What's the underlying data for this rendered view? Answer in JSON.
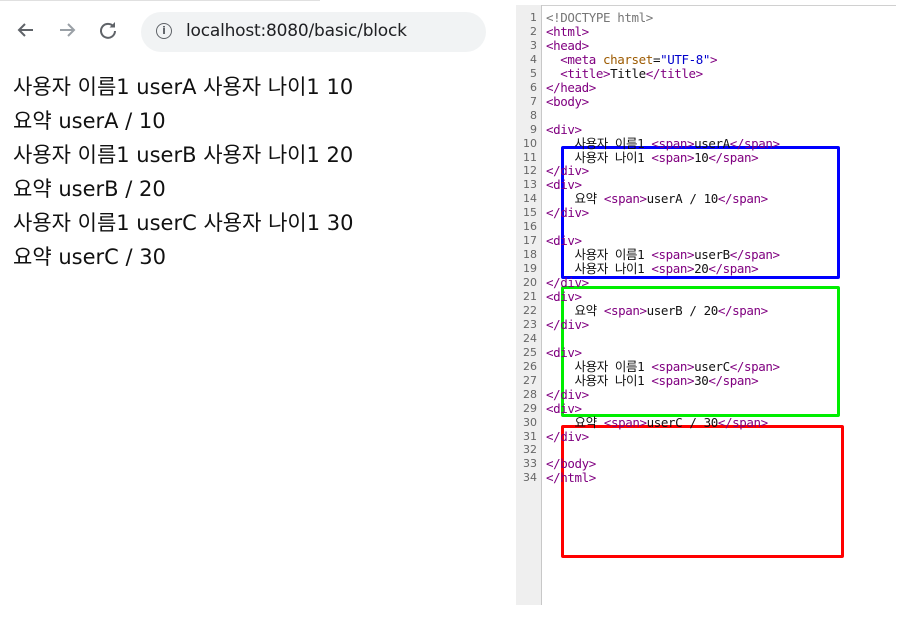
{
  "browser": {
    "back_icon": "arrow-left-icon",
    "forward_icon": "arrow-right-icon",
    "reload_icon": "reload-icon",
    "info_icon": "info-icon",
    "url": "localhost:8080/basic/block"
  },
  "page": {
    "lines": [
      "사용자 이름1 userA 사용자 나이1 10",
      "요약 userA / 10",
      "사용자 이름1 userB 사용자 나이1 20",
      "요약 userB / 20",
      "사용자 이름1 userC 사용자 나이1 30",
      "요약 userC / 30"
    ]
  },
  "editor": {
    "lines": [
      {
        "n": "1",
        "text": "<!DOCTYPE html>"
      },
      {
        "n": "2",
        "text": "<html>"
      },
      {
        "n": "3",
        "text": "<head>"
      },
      {
        "n": "4",
        "text": "  <meta charset=\"UTF-8\">"
      },
      {
        "n": "5",
        "text": "  <title>Title</title>"
      },
      {
        "n": "6",
        "text": "</head>"
      },
      {
        "n": "7",
        "text": "<body>"
      },
      {
        "n": "8",
        "text": ""
      },
      {
        "n": "9",
        "text": "<div>"
      },
      {
        "n": "10",
        "text": "    사용자 이름1 <span>userA</span>"
      },
      {
        "n": "11",
        "text": "    사용자 나이1 <span>10</span>"
      },
      {
        "n": "12",
        "text": "</div>"
      },
      {
        "n": "13",
        "text": "<div>"
      },
      {
        "n": "14",
        "text": "    요약 <span>userA / 10</span>"
      },
      {
        "n": "15",
        "text": "</div>"
      },
      {
        "n": "16",
        "text": ""
      },
      {
        "n": "17",
        "text": "<div>"
      },
      {
        "n": "18",
        "text": "    사용자 이름1 <span>userB</span>"
      },
      {
        "n": "19",
        "text": "    사용자 나이1 <span>20</span>"
      },
      {
        "n": "20",
        "text": "</div>"
      },
      {
        "n": "21",
        "text": "<div>"
      },
      {
        "n": "22",
        "text": "    요약 <span>userB / 20</span>"
      },
      {
        "n": "23",
        "text": "</div>"
      },
      {
        "n": "24",
        "text": ""
      },
      {
        "n": "25",
        "text": "<div>"
      },
      {
        "n": "26",
        "text": "    사용자 이름1 <span>userC</span>"
      },
      {
        "n": "27",
        "text": "    사용자 나이1 <span>30</span>"
      },
      {
        "n": "28",
        "text": "</div>"
      },
      {
        "n": "29",
        "text": "<div>"
      },
      {
        "n": "30",
        "text": "    요약 <span>userC / 30</span>"
      },
      {
        "n": "31",
        "text": "</div>"
      },
      {
        "n": "32",
        "text": ""
      },
      {
        "n": "33",
        "text": "</body>"
      },
      {
        "n": "34",
        "text": "</html>"
      }
    ],
    "highlight_colors": [
      "#0000ff",
      "#00ee00",
      "#ff0000"
    ]
  }
}
